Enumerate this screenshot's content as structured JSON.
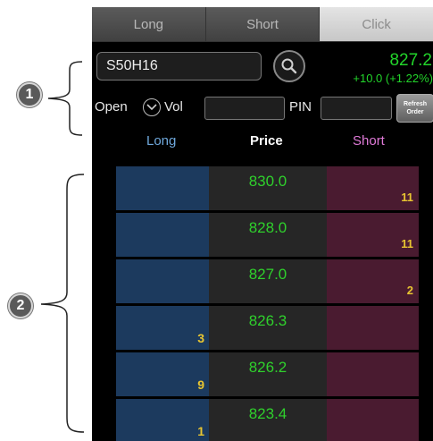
{
  "tabs": [
    {
      "label": "Long",
      "active": false
    },
    {
      "label": "Short",
      "active": false
    },
    {
      "label": "Click",
      "active": true
    }
  ],
  "symbol": {
    "value": "S50H16"
  },
  "quote": {
    "last": "827.2",
    "change": "+10.0 (+1.22%)"
  },
  "order": {
    "open_label": "Open",
    "vol_label": "Vol",
    "vol_value": "",
    "pin_label": "PIN",
    "pin_value": "",
    "refresh_line1": "Refresh",
    "refresh_line2": "Order"
  },
  "ladder_header": {
    "long": "Long",
    "price": "Price",
    "short": "Short"
  },
  "ladder_rows": [
    {
      "long": "",
      "price": "830.0",
      "short": "11"
    },
    {
      "long": "",
      "price": "828.0",
      "short": "11"
    },
    {
      "long": "",
      "price": "827.0",
      "short": "2"
    },
    {
      "long": "3",
      "price": "826.3",
      "short": ""
    },
    {
      "long": "9",
      "price": "826.2",
      "short": ""
    },
    {
      "long": "1",
      "price": "823.4",
      "short": ""
    }
  ],
  "callouts": {
    "one": "1",
    "two": "2"
  },
  "colors": {
    "price_green": "#22d42a",
    "qty_yellow": "#e8c531",
    "long_blue": "#1c3a5e",
    "short_maroon": "#4a1b30",
    "long_header": "#6fa8dc",
    "short_header": "#e07ad8"
  },
  "icons": {
    "search": "search-icon",
    "dropdown": "chevron-down-icon"
  }
}
